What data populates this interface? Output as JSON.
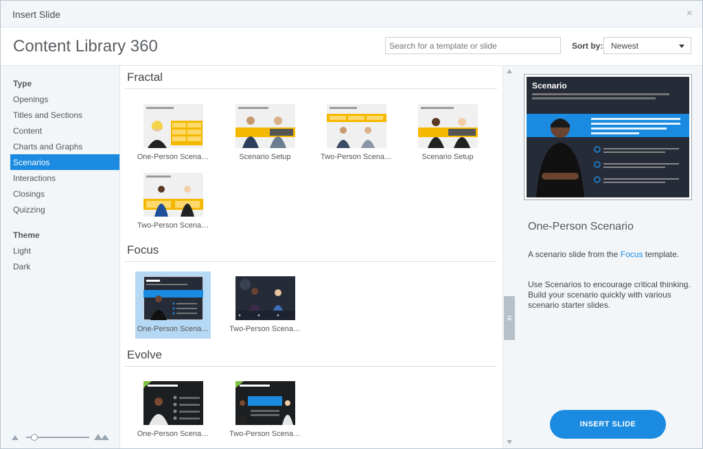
{
  "window": {
    "title": "Insert Slide",
    "close_glyph": "×"
  },
  "header": {
    "app_title": "Content Library 360",
    "search_placeholder": "Search for a template or slide",
    "sort_label": "Sort by:",
    "sort_value": "Newest"
  },
  "sidebar": {
    "type_heading": "Type",
    "type_items": [
      "Openings",
      "Titles and Sections",
      "Content",
      "Charts and Graphs",
      "Scenarios",
      "Interactions",
      "Closings",
      "Quizzing"
    ],
    "active_item": "Scenarios",
    "theme_heading": "Theme",
    "theme_items": [
      "Light",
      "Dark"
    ]
  },
  "groups": [
    {
      "title": "Fractal",
      "items": [
        {
          "label": "One-Person  Scena…",
          "style": "fractal-one"
        },
        {
          "label": "Scenario Setup",
          "style": "fractal-setup"
        },
        {
          "label": "Two-Person  Scena…",
          "style": "fractal-two"
        },
        {
          "label": "Scenario Setup",
          "style": "fractal-setup2"
        },
        {
          "label": "Two-Person  Scena…",
          "style": "fractal-two2"
        }
      ]
    },
    {
      "title": "Focus",
      "items": [
        {
          "label": "One-Person  Scena…",
          "style": "focus-one",
          "selected": true
        },
        {
          "label": "Two-Person  Scena…",
          "style": "focus-two"
        }
      ]
    },
    {
      "title": "Evolve",
      "items": [
        {
          "label": "One-Person  Scena…",
          "style": "evolve-one"
        },
        {
          "label": "Two-Person  Scena…",
          "style": "evolve-two"
        }
      ]
    }
  ],
  "preview": {
    "slide_heading": "Scenario",
    "title": "One-Person Scenario",
    "desc_prefix": "A scenario slide from the ",
    "desc_link": "Focus",
    "desc_suffix": " template.",
    "body": "Use Scenarios to encourage critical thinking. Build your scenario quickly with various scenario starter slides.",
    "insert_label": "INSERT SLIDE"
  },
  "colors": {
    "accent": "#1a8be0",
    "fractal_yellow": "#f5b800",
    "focus_dark": "#262b38",
    "evolve_green": "#7dc142"
  },
  "icons": {
    "close": "close-icon",
    "dropdown": "chevron-down-icon",
    "zoom_small": "mountain-small-icon",
    "zoom_large": "mountain-large-icon"
  }
}
